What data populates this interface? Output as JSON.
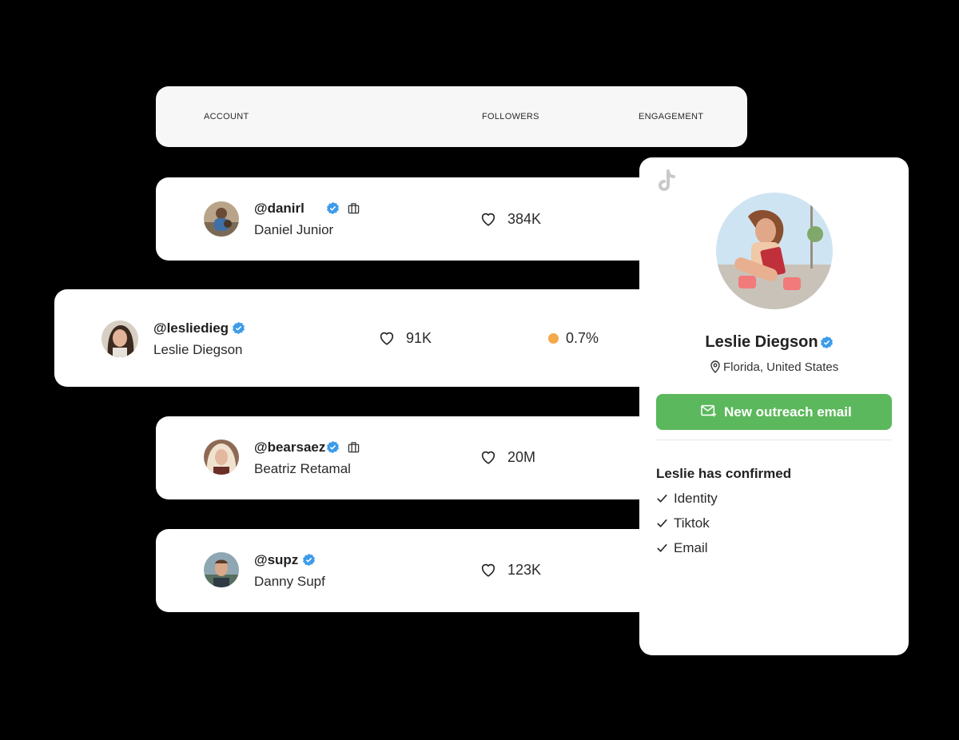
{
  "table": {
    "columns": [
      "ACCOUNT",
      "FOLLOWERS",
      "ENGAGEMENT"
    ]
  },
  "rows": [
    {
      "handle": "@danirl",
      "name": "Daniel Junior",
      "followers": "384K",
      "verified": true,
      "has_bag": true
    },
    {
      "handle": "@lesliedieg",
      "name": "Leslie Diegson",
      "followers": "91K",
      "engagement": "0.7%",
      "verified": true,
      "highlighted": true
    },
    {
      "handle": "@bearsaez",
      "name": "Beatriz Retamal",
      "followers": "20M",
      "verified": true,
      "has_bag": true
    },
    {
      "handle": "@supz",
      "name": "Danny Supf",
      "followers": "123K",
      "verified": true
    }
  ],
  "profile": {
    "platform_icon": "tiktok-icon",
    "name": "Leslie Diegson",
    "location": "Florida, United States",
    "cta_label": "New outreach email",
    "confirmed_title": "Leslie has confirmed",
    "confirmed_items": [
      "Identity",
      "Tiktok",
      "Email"
    ]
  },
  "colors": {
    "cta_green": "#5cb85c",
    "verified_blue": "#3d9be9",
    "engagement_dot": "#f5a94a"
  }
}
